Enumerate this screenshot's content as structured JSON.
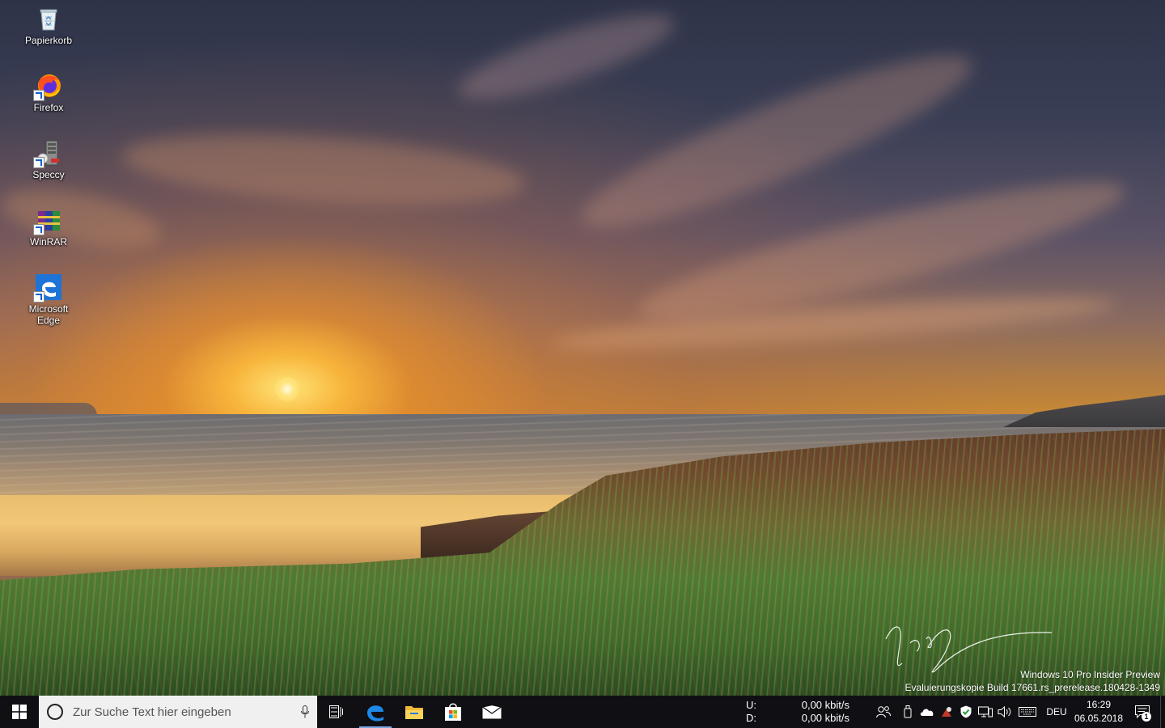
{
  "desktop": {
    "icons": [
      {
        "label": "Papierkorb",
        "icon": "recycle-bin-icon"
      },
      {
        "label": "Firefox",
        "icon": "firefox-icon"
      },
      {
        "label": "Speccy",
        "icon": "speccy-icon"
      },
      {
        "label": "WinRAR",
        "icon": "winrar-icon"
      },
      {
        "label": "Microsoft Edge",
        "icon": "edge-icon"
      }
    ]
  },
  "watermark": {
    "line1": "Windows 10 Pro Insider Preview",
    "line2": "Evaluierungskopie Build 17661.rs_prerelease.180428-1349"
  },
  "taskbar": {
    "search_placeholder": "Zur Suche Text hier eingeben",
    "pinned": [
      "edge-icon",
      "file-explorer-icon",
      "store-icon",
      "mail-icon"
    ],
    "network_monitor": {
      "up_label": "U:",
      "up_value": "0,00 kbit/s",
      "down_label": "D:",
      "down_value": "0,00 kbit/s"
    },
    "language": "DEU",
    "time": "16:29",
    "date": "06.05.2018",
    "notification_count": "1"
  },
  "colors": {
    "taskbar_bg": "#101014",
    "accent": "#0078d7"
  }
}
